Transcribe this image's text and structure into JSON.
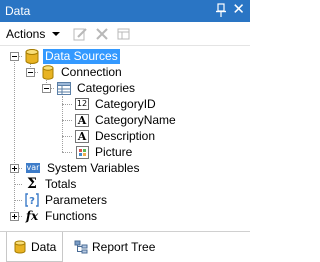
{
  "window": {
    "title": "Data"
  },
  "toolbar": {
    "actions_label": "Actions"
  },
  "tree": {
    "root": "Data Sources",
    "connection": "Connection",
    "table": "Categories",
    "fields": [
      {
        "name": "CategoryID",
        "type": "number"
      },
      {
        "name": "CategoryName",
        "type": "text"
      },
      {
        "name": "Description",
        "type": "text"
      },
      {
        "name": "Picture",
        "type": "image"
      }
    ],
    "system_variables": "System Variables",
    "system_variables_badge": "var",
    "totals": "Totals",
    "parameters": "Parameters",
    "functions": "Functions",
    "glyphs": {
      "number": "12",
      "text": "A",
      "totals": "Σ",
      "functions": "fx"
    }
  },
  "tabs": [
    {
      "label": "Data",
      "active": true
    },
    {
      "label": "Report Tree",
      "active": false
    }
  ],
  "colors": {
    "title_bar": "#2a75c4",
    "selection": "#3399ff",
    "db_gold": "#e8b323"
  }
}
